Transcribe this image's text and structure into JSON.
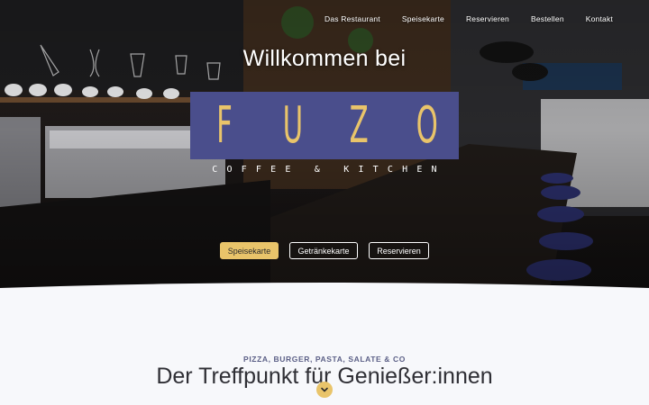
{
  "nav": {
    "items": [
      {
        "label": "Das Restaurant"
      },
      {
        "label": "Speisekarte"
      },
      {
        "label": "Reservieren"
      },
      {
        "label": "Bestellen"
      },
      {
        "label": "Kontakt"
      }
    ]
  },
  "hero": {
    "welcome": "Willkommen bei",
    "logo_letters": [
      "F",
      "U",
      "Z",
      "O"
    ],
    "logo_sub": "COFFEE & KITCHEN",
    "buttons": {
      "menu": "Speisekarte",
      "drinks": "Getränkekarte",
      "reserve": "Reservieren"
    }
  },
  "section": {
    "kicker": "PIZZA, BURGER, PASTA, SALATE & CO",
    "title": "Der Treffpunkt für Genießer:innen"
  },
  "colors": {
    "accent_gold": "#e9c46a",
    "logo_purple": "#4a4e8c",
    "page_bg": "#f7f8fb"
  },
  "icons": {
    "scroll": "chevron-down-icon"
  }
}
